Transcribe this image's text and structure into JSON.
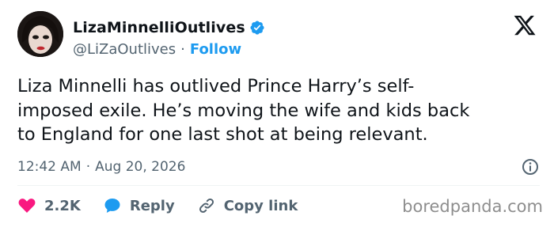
{
  "user": {
    "display_name": "LizaMinnelliOutlives",
    "handle": "@LiZaOutlives",
    "separator": "·",
    "follow_label": "Follow"
  },
  "tweet": {
    "lines": [
      "Liza Minnelli has outlived Prince Harry’s self-",
      "imposed exile. He’s moving the wife and kids back",
      "to England for one last shot at being relevant."
    ],
    "time": "12:42 AM",
    "separator": "·",
    "date": "Aug 20, 2026"
  },
  "actions": {
    "likes": "2.2K",
    "reply_label": "Reply",
    "copy_label": "Copy link"
  },
  "watermark": "boredpanda.com",
  "colors": {
    "accent": "#1d9bf0",
    "like": "#f91880",
    "text": "#0f1419",
    "muted": "#536471"
  },
  "icons": [
    "verified-badge-icon",
    "x-logo-icon",
    "info-icon",
    "heart-icon",
    "reply-bubble-icon",
    "link-icon"
  ]
}
